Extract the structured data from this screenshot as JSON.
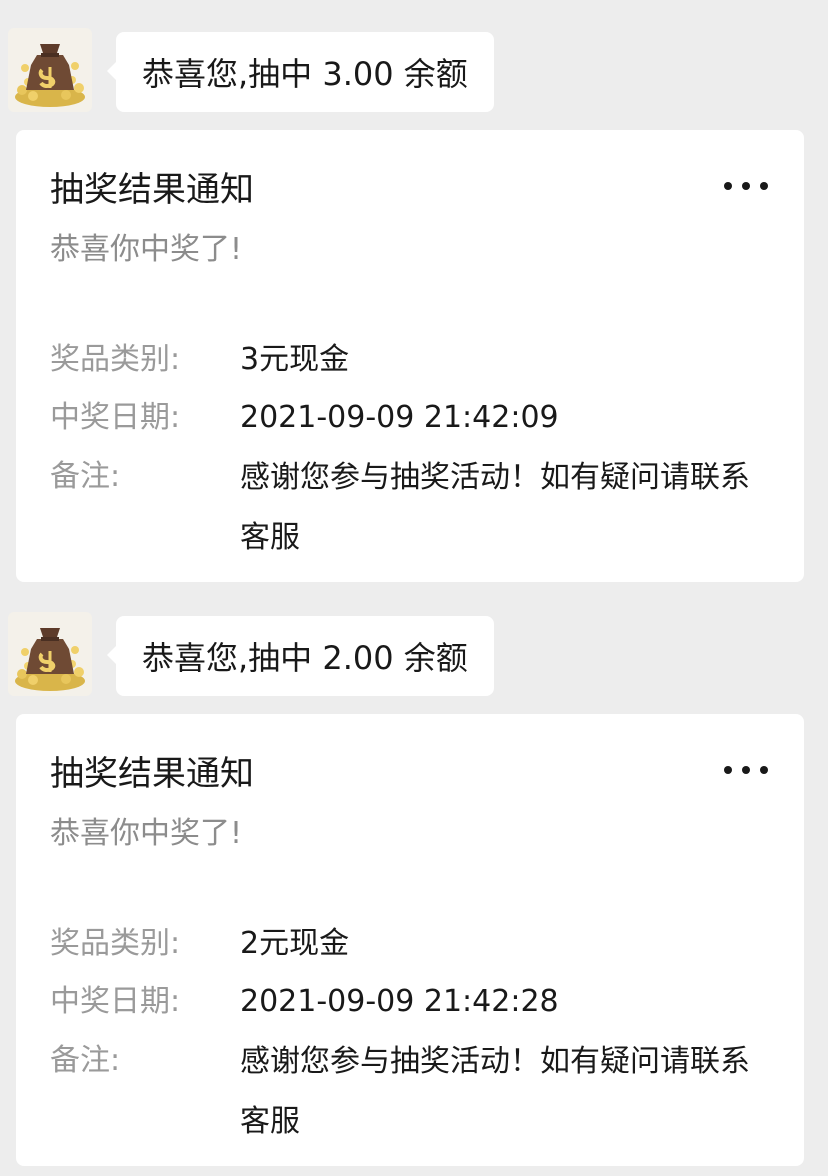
{
  "messages": [
    {
      "avatar_icon": "money-bag-icon",
      "bubble_text": "恭喜您,抽中 3.00 余额",
      "card": {
        "title": "抽奖结果通知",
        "subtitle": "恭喜你中奖了!",
        "prize_label": "奖品类别:",
        "prize_value": "3元现金",
        "date_label": "中奖日期:",
        "date_value": "2021-09-09 21:42:09",
        "remark_label": "备注:",
        "remark_value": "感谢您参与抽奖活动！如有疑问请联系客服",
        "more_icon": "more-icon"
      }
    },
    {
      "avatar_icon": "money-bag-icon",
      "bubble_text": "恭喜您,抽中 2.00 余额",
      "card": {
        "title": "抽奖结果通知",
        "subtitle": "恭喜你中奖了!",
        "prize_label": "奖品类别:",
        "prize_value": "2元现金",
        "date_label": "中奖日期:",
        "date_value": "2021-09-09 21:42:28",
        "remark_label": "备注:",
        "remark_value": "感谢您参与抽奖活动！如有疑问请联系客服",
        "more_icon": "more-icon"
      }
    }
  ],
  "colors": {
    "background": "#ededed",
    "card": "#ffffff",
    "primary_text": "#191919",
    "secondary_text": "#8c8c8c",
    "gold": "#d9b54a",
    "bag": "#6f4a34"
  }
}
